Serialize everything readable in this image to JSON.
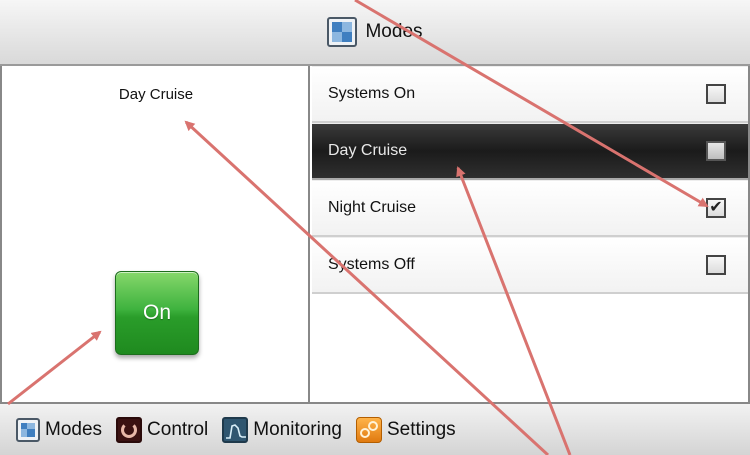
{
  "header": {
    "title": "Modes",
    "icon": "modes-grid-icon"
  },
  "left_panel": {
    "current_mode": "Day Cruise",
    "power_button": {
      "label": "On",
      "color": "#3fb33f"
    }
  },
  "modes": [
    {
      "label": "Systems On",
      "checked": false,
      "selected": false
    },
    {
      "label": "Day Cruise",
      "checked": false,
      "selected": true
    },
    {
      "label": "Night Cruise",
      "checked": true,
      "selected": false
    },
    {
      "label": "Systems Off",
      "checked": false,
      "selected": false
    }
  ],
  "footer": {
    "tabs": [
      {
        "label": "Modes",
        "icon": "modes-grid-icon"
      },
      {
        "label": "Control",
        "icon": "control-icon"
      },
      {
        "label": "Monitoring",
        "icon": "monitoring-icon"
      },
      {
        "label": "Settings",
        "icon": "settings-icon"
      }
    ]
  },
  "annotation_color": "#d9736f"
}
